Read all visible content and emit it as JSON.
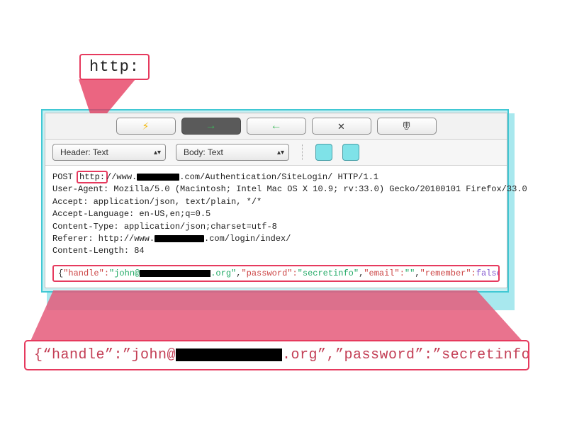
{
  "topCallout": "http:",
  "toolbar": {
    "bolt": "bolt-icon",
    "forward": "arrow-right-icon",
    "back": "arrow-left-icon",
    "close": "close-icon",
    "script": "scroll-icon"
  },
  "dropdowns": {
    "header": "Header: Text",
    "body": "Body: Text"
  },
  "request": {
    "method": "POST",
    "scheme": "http:",
    "after_scheme": "//www.",
    "path_after_redact": ".com/Authentication/SiteLogin/ HTTP/1.1",
    "ua": "User-Agent: Mozilla/5.0 (Macintosh; Intel Mac OS X 10.9; rv:33.0) Gecko/20100101 Firefox/33.0",
    "accept": "Accept: application/json, text/plain, */*",
    "accept_lang": "Accept-Language: en-US,en;q=0.5",
    "ctype": "Content-Type: application/json;charset=utf-8",
    "referer_pre": "Referer: http://www.",
    "referer_post": ".com/login/index/",
    "clen": "Content-Length: 84"
  },
  "body": {
    "open": "{",
    "k_handle": "\"handle\"",
    "v_handle_pre": "\"john@",
    "v_handle_post": ".org\"",
    "k_password": "\"password\"",
    "v_password": "\"secretinfo\"",
    "k_email": "\"email\"",
    "v_email": "\"\"",
    "k_remember": "\"remember\"",
    "v_remember": "false",
    "close": "}"
  },
  "bottomCallout": {
    "pre": "{“handle”:”john@",
    "mid": ".org”,”password”:”secretinfo”",
    "post": ""
  }
}
